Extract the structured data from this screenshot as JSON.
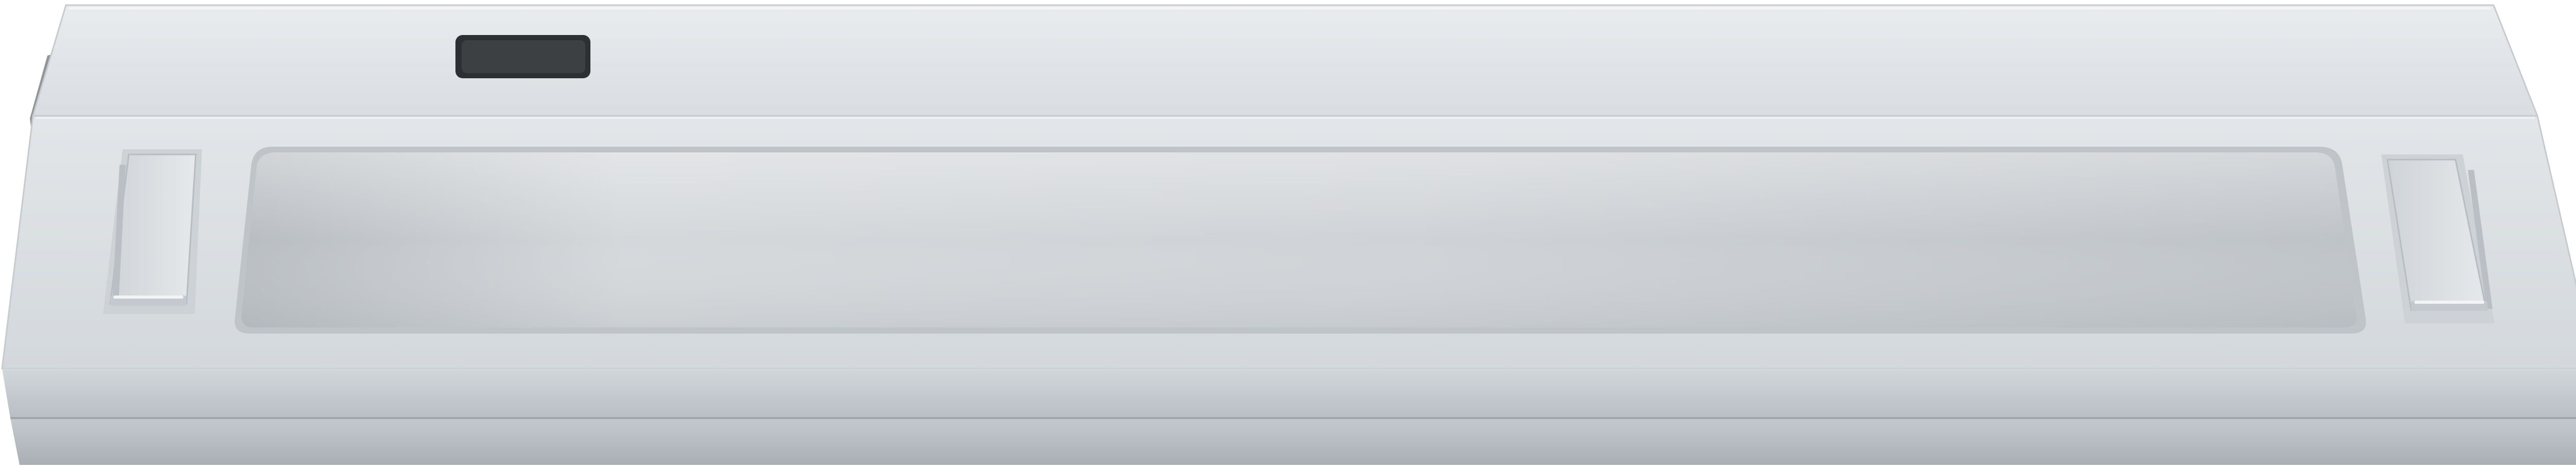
{
  "image": {
    "subject": "led-under-cabinet-light-bar",
    "colors": {
      "background": "#ffffff",
      "housing_light": "#e3e7ea",
      "housing_mid": "#c9ced3",
      "housing_dark": "#aeb4ba",
      "diffuser": "#c5cace",
      "switch": "#3c4043"
    }
  }
}
